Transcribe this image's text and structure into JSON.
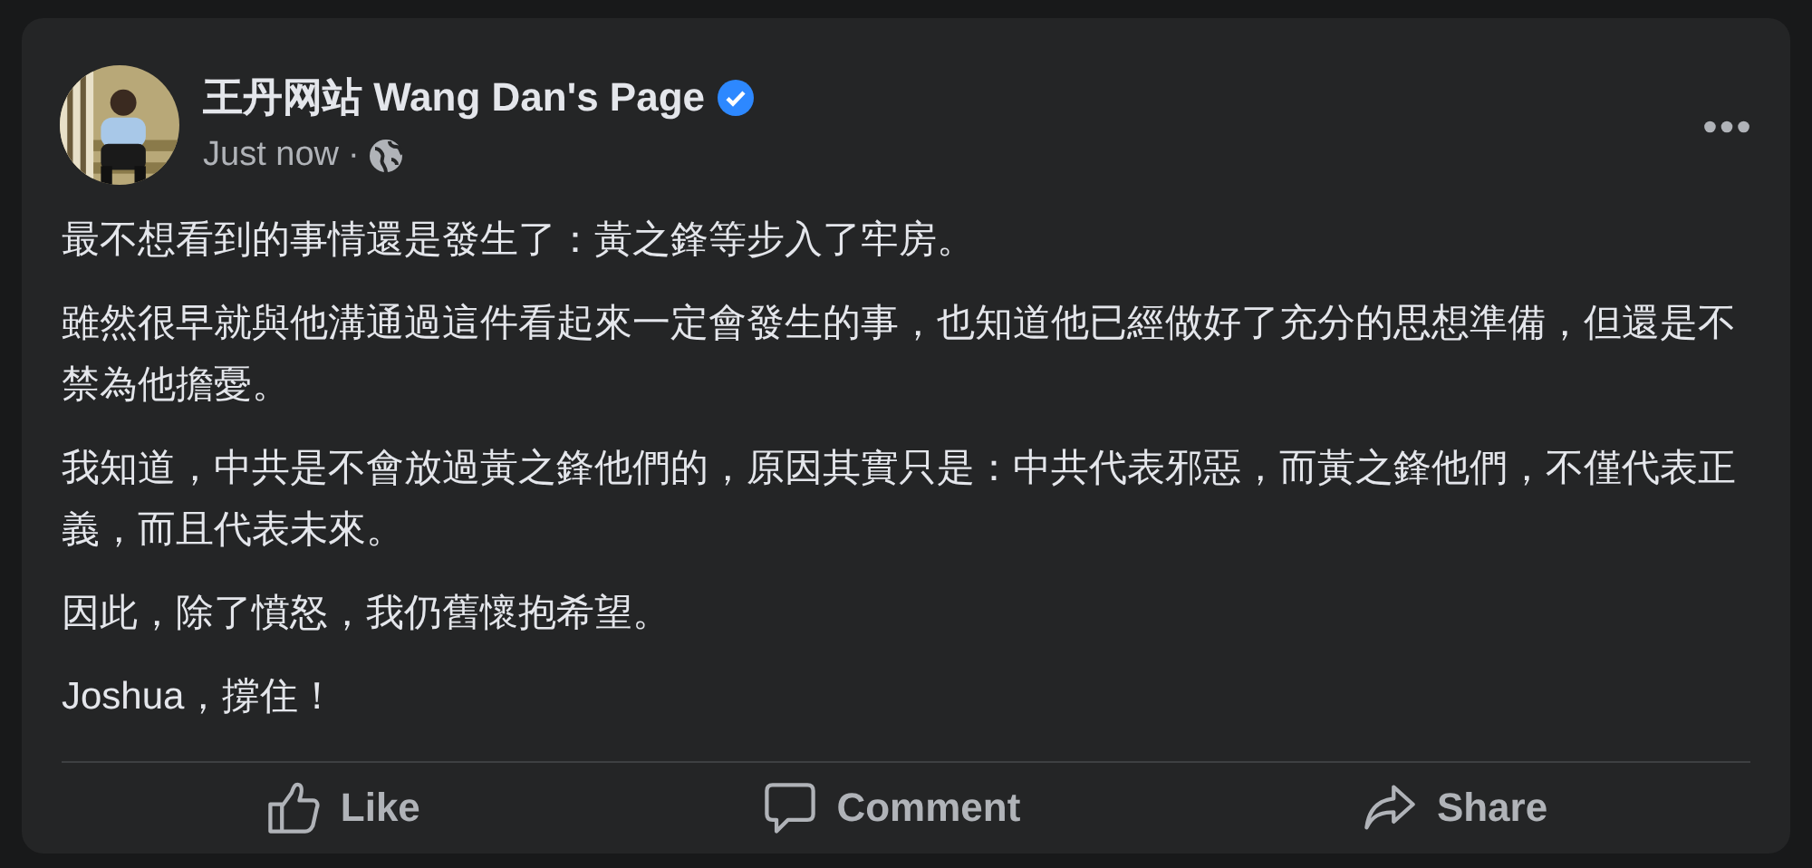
{
  "post": {
    "author": "王丹网站 Wang Dan's Page",
    "verified": true,
    "time": "Just now",
    "separator": "·",
    "paragraphs": [
      "最不想看到的事情還是發生了：黃之鋒等步入了牢房。",
      "雖然很早就與他溝通過這件看起來一定會發生的事，也知道他已經做好了充分的思想準備，但還是不禁為他擔憂。",
      "我知道，中共是不會放過黃之鋒他們的，原因其實只是：中共代表邪惡，而黃之鋒他們，不僅代表正義，而且代表未來。",
      "因此，除了憤怒，我仍舊懷抱希望。",
      "Joshua，撐住！"
    ]
  },
  "actions": [
    {
      "kind": "like",
      "label": "Like"
    },
    {
      "kind": "comment",
      "label": "Comment"
    },
    {
      "kind": "share",
      "label": "Share"
    }
  ]
}
